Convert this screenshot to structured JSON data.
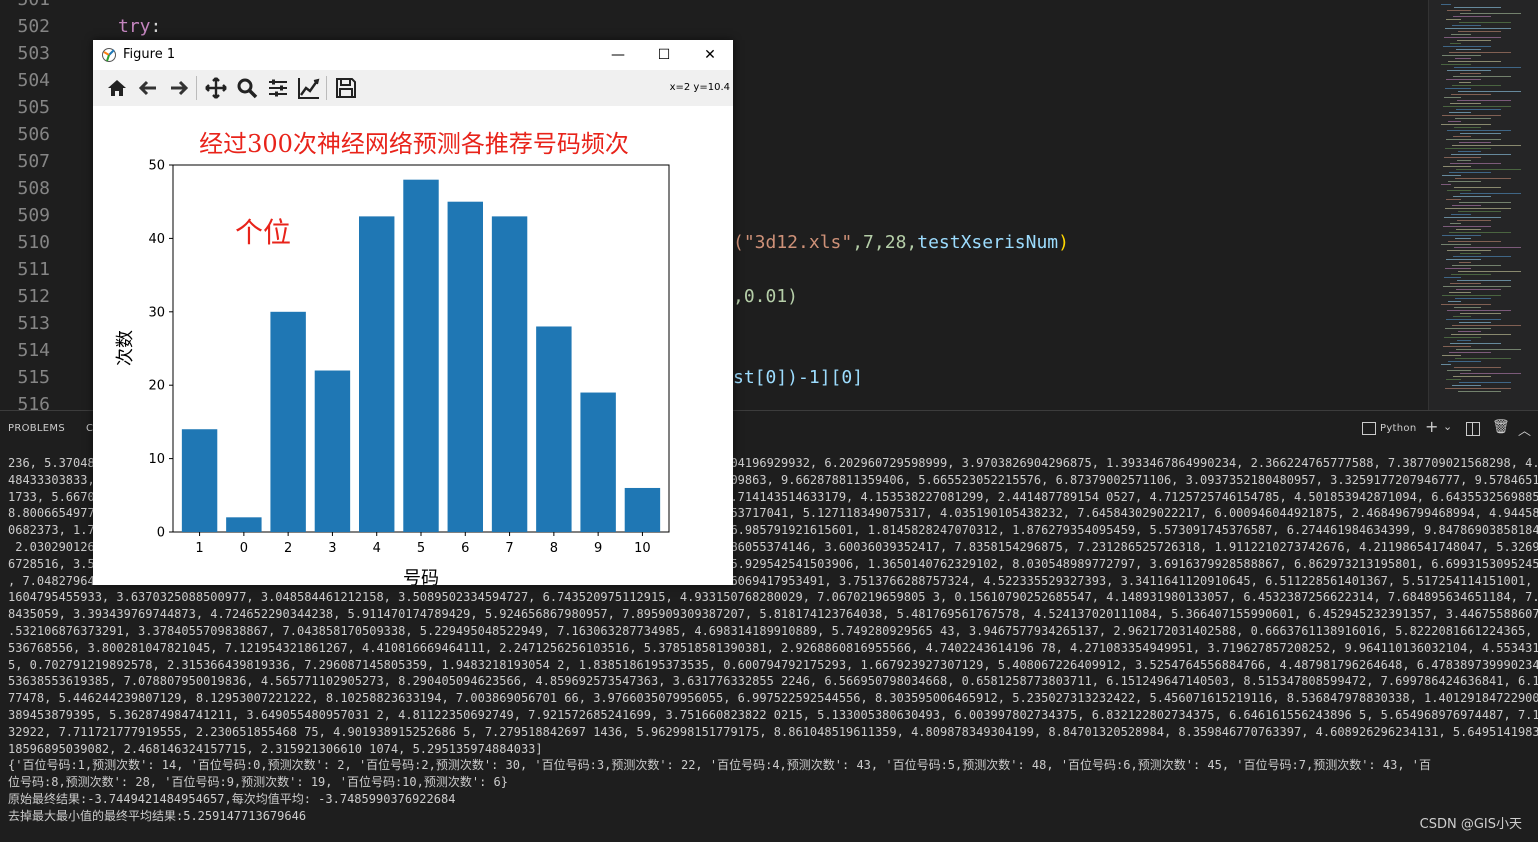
{
  "editor": {
    "line_numbers": [
      "501",
      "502",
      "503",
      "504",
      "505",
      "506",
      "507",
      "508",
      "509",
      "510",
      "511",
      "512",
      "513",
      "514",
      "515",
      "516"
    ],
    "keyword": "try",
    "colon": ":",
    "frag510a": "(\"3d12.xls\"",
    "frag510b": ",7,28,",
    "frag510c": "testXserisNum",
    "frag510d": ")",
    "frag512": ",0.01)",
    "frag515a": "st[0])-1][0]"
  },
  "panel": {
    "tab_problems": "PROBLEMS",
    "tab_c": "C",
    "python_label": "Python",
    "output_lines": [
      "236, 5.37048                                                                                       704196929932, 6.202960729598999, 3.9703826904296875, 1.3933467864990234, 2.366224765777588, 7.387709021568298, 4.265",
      "48433303833,                                                                                        09863, 9.662878811359406, 5.665523052215576, 6.87379002571106, 3.0937352180480957, 3.3259177207946777, 9.5784651961",
      "1733, 5.6670                                                                                        .714143514633179, 4.153538227081299, 2.441487789154 0527, 4.7125725746154785, 4.501853942871094, 6.643553256988525,",
      "8.8006654977                                                                                        53717041, 5.127118349075317, 4.035190105438232, 7.645843029022217, 6.000946044921875, 2.468496799468994, 4.94458723",
      "0682373, 1.7                                                                                        6.985791921615601, 1.8145828247070312, 1.876279354095459, 5.573091745376587, 6.274461984634399, 9.847869038581848,",
      " 2.030290126                                                                                        86055374146, 3.60036039352417, 7.8358154296875, 7.231286525726318, 1.9112210273742676, 4.211986541748047, 5.3269614",
      "6728516, 3.5                                                                                        5.929542541503906, 1.3650140762329102, 8.030548989772797, 3.6916379928588867, 6.862973213195801, 6.69931530952453",
      ", 7.04827964                                                                                        6069417953491, 3.7513766288757324, 4.522335529327393, 3.3411641120910645, 6.511228561401367, 5.517254114151001, 5.25",
      "1604795455933, 3.6370325088500977, 3.048584461212158, 3.5089502334594727, 6.743520975112915, 4.933150768280029, 7.0670219659805 3, 0.15610790252685547, 4.148931980133057, 6.4532387256622314, 7.684895634651184, 7.5545339",
      "8435059, 3.393439769744873, 4.724652290344238, 5.911470174789429, 5.924656867980957, 7.895909309387207, 5.818174123764038, 5.481769561767578, 4.524137020111084, 5.366407155990601, 6.452945232391357, 3.446755886077881, 6",
      ".532106876373291, 3.3784055709838867, 7.043858170509338, 5.229495048522949, 7.163063287734985, 4.698314189910889, 5.749280929565 43, 3.9467577934265137, 2.962172031402588, 0.6663761138916016, 5.8222081661224365, 9.022823",
      "536768556, 3.800281047821045, 7.121954321861267, 4.410816669464111, 2.2471256256103516, 5.378518581390381, 2.9268860816955566, 4.7402243614196 78, 4.271083354949951, 3.719627857208252, 9.964110136032104, 4.55343103408813",
      "5, 0.702791219892578, 2.315366439819336, 7.296087145805359, 1.9483218193054 2, 1.8385186195373535, 0.600794792175293, 1.667923927307129, 5.408067226409912, 3.5254764556884766, 4.487981796264648, 6.478389739990234, 5.59",
      "53638553619385, 7.078807950019836, 4.565771102905273, 8.290405094623566, 4.859692573547363, 3.631776332855 2246, 6.566950798034668, 0.6581258773803711, 6.151249647140503, 8.515347808599472, 7.699786424636841, 6.185695409",
      "77478, 5.446244239807129, 8.12953007221222, 8.10258823633194, 7.003869056701 66, 3.9766035079956055, 6.997522592544556, 8.303595006465912, 5.235027313232422, 5.456071615219116, 8.536847978830338, 1.401291847229004, 6.028",
      "389453879395, 5.362874984741211, 3.649055480957031 2, 4.81122350692749, 7.921572685241699, 3.751660823822 0215, 5.133005380630493, 6.003997802734375, 6.832122802734375, 6.646161556243896 5, 5.654968976974487, 7.1560078859",
      "32922, 7.711721777919555, 2.230651855468 75, 4.901938915252686 5, 7.279518842697 1436, 5.962998151779175, 8.861048519611359, 4.809878349304199, 8.84701320528984, 8.359846770763397, 4.608926296234131, 5.649514198303223, 9.0",
      "18596895039082, 2.468146324157715, 2.315921306610 1074, 5.295135974884033]",
      "{'百位号码:1,预测次数': 14, '百位号码:0,预测次数': 2, '百位号码:2,预测次数': 30, '百位号码:3,预测次数': 22, '百位号码:4,预测次数': 43, '百位号码:5,预测次数': 48, '百位号码:6,预测次数': 45, '百位号码:7,预测次数': 43, '百",
      "位号码:8,预测次数': 28, '百位号码:9,预测次数': 19, '百位号码:10,预测次数': 6}",
      "原始最终结果:-3.7449421484954657,每次均值平均: -3.7485990376922684",
      "去掉最大最小值的最终平均结果:5.259147713679646"
    ],
    "watermark": "CSDN @GIS小天"
  },
  "figure": {
    "window_title": "Figure 1",
    "coords": "x=2  y=10.4",
    "buttons": {
      "minimize": "—",
      "maximize": "☐",
      "close": "✕"
    }
  },
  "chart_data": {
    "type": "bar",
    "title": "经过300次神经网络预测各推荐号码频次",
    "annotation": "个位",
    "xlabel": "号码",
    "ylabel": "次数",
    "categories": [
      "1",
      "0",
      "2",
      "3",
      "4",
      "5",
      "6",
      "7",
      "8",
      "9",
      "10"
    ],
    "values": [
      14,
      2,
      30,
      22,
      43,
      48,
      45,
      43,
      28,
      19,
      6
    ],
    "ylim": [
      0,
      50
    ],
    "yticks": [
      "0",
      "10",
      "20",
      "30",
      "40",
      "50"
    ],
    "bar_color": "#1f77b4",
    "title_color": "#e8231a",
    "annotation_color": "#e8231a",
    "grid": false
  }
}
